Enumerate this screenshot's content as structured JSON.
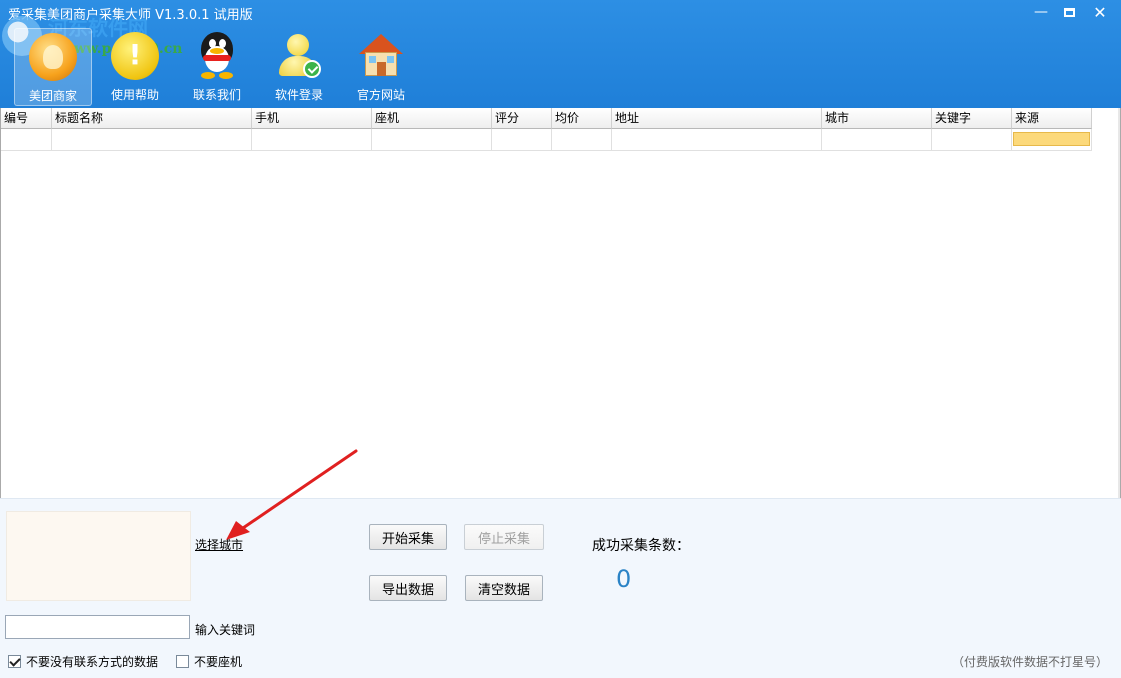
{
  "window": {
    "title": "爱采集美团商户采集大师 V1.3.0.1 试用版",
    "controls": {
      "minimize": "—",
      "close": "✕"
    }
  },
  "watermark": {
    "name": "河东软件网",
    "url": "www.pc0359.cn"
  },
  "toolbar": {
    "items": [
      {
        "label": "美团商家",
        "icon": "meituan-icon",
        "active": true
      },
      {
        "label": "使用帮助",
        "icon": "help-icon",
        "active": false
      },
      {
        "label": "联系我们",
        "icon": "qq-penguin-icon",
        "active": false
      },
      {
        "label": "软件登录",
        "icon": "user-login-icon",
        "active": false
      },
      {
        "label": "官方网站",
        "icon": "home-icon",
        "active": false
      }
    ]
  },
  "table": {
    "columns": [
      "编号",
      "标题名称",
      "手机",
      "座机",
      "评分",
      "均价",
      "地址",
      "城市",
      "关键字",
      "来源"
    ],
    "rows": [
      [
        "",
        "",
        "",
        "",
        "",
        "",
        "",
        "",
        "",
        ""
      ]
    ],
    "accent_selected": "#fcd97b"
  },
  "panel": {
    "select_city_link": "选择城市",
    "keyword_input": {
      "value": "",
      "placeholder": ""
    },
    "keyword_label": "输入关键词",
    "checkboxes": [
      {
        "label": "不要没有联系方式的数据",
        "checked": true
      },
      {
        "label": "不要座机",
        "checked": false
      }
    ],
    "buttons": {
      "start": "开始采集",
      "stop": "停止采集",
      "export": "导出数据",
      "clear": "清空数据"
    },
    "success_count_label": "成功采集条数：",
    "success_count_value": "0",
    "footnote": "（付费版软件数据不打星号）"
  },
  "colors": {
    "header_blue": "#1f7fd8",
    "count_blue": "#2b83c6",
    "annotation_arrow": "#e02020"
  }
}
